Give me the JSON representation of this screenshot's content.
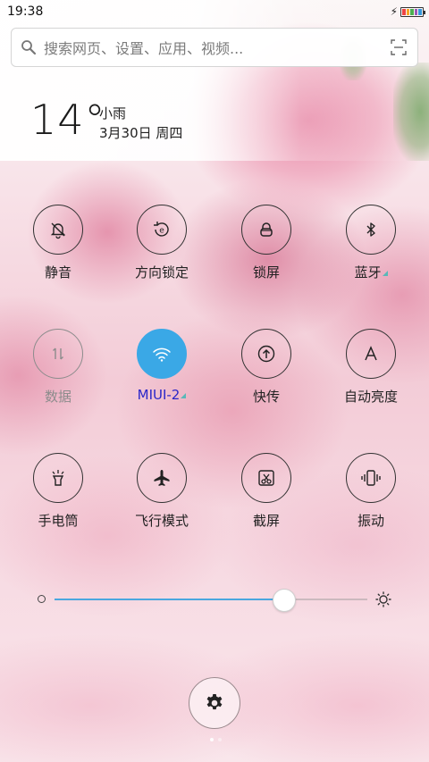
{
  "status_bar": {
    "time": "19:38"
  },
  "search": {
    "placeholder": "搜索网页、设置、应用、视频..."
  },
  "weather": {
    "temperature": "14°",
    "condition": "小雨",
    "date": "3月30日 周四"
  },
  "toggles": [
    {
      "id": "mute",
      "label": "静音",
      "icon": "bell-off-icon",
      "state": "off"
    },
    {
      "id": "rotation",
      "label": "方向锁定",
      "icon": "rotation-lock-icon",
      "state": "off"
    },
    {
      "id": "lock",
      "label": "锁屏",
      "icon": "lock-icon",
      "state": "off"
    },
    {
      "id": "bluetooth",
      "label": "蓝牙",
      "icon": "bluetooth-icon",
      "state": "off"
    },
    {
      "id": "data",
      "label": "数据",
      "icon": "data-arrows-icon",
      "state": "disabled"
    },
    {
      "id": "wifi",
      "label": "MIUI-2",
      "icon": "wifi-icon",
      "state": "on"
    },
    {
      "id": "transfer",
      "label": "快传",
      "icon": "share-upload-icon",
      "state": "off"
    },
    {
      "id": "auto_brightness",
      "label": "自动亮度",
      "icon": "letter-a-icon",
      "state": "off"
    },
    {
      "id": "flashlight",
      "label": "手电筒",
      "icon": "flashlight-icon",
      "state": "off"
    },
    {
      "id": "airplane",
      "label": "飞行模式",
      "icon": "airplane-icon",
      "state": "off"
    },
    {
      "id": "screenshot",
      "label": "截屏",
      "icon": "scissors-icon",
      "state": "off"
    },
    {
      "id": "vibrate",
      "label": "振动",
      "icon": "vibrate-icon",
      "state": "off"
    }
  ],
  "brightness": {
    "level": 0.73
  },
  "colors": {
    "accent": "#3aa8e6",
    "wifi_label": "#2a26c9",
    "slider_fill": "#4aa7df"
  }
}
